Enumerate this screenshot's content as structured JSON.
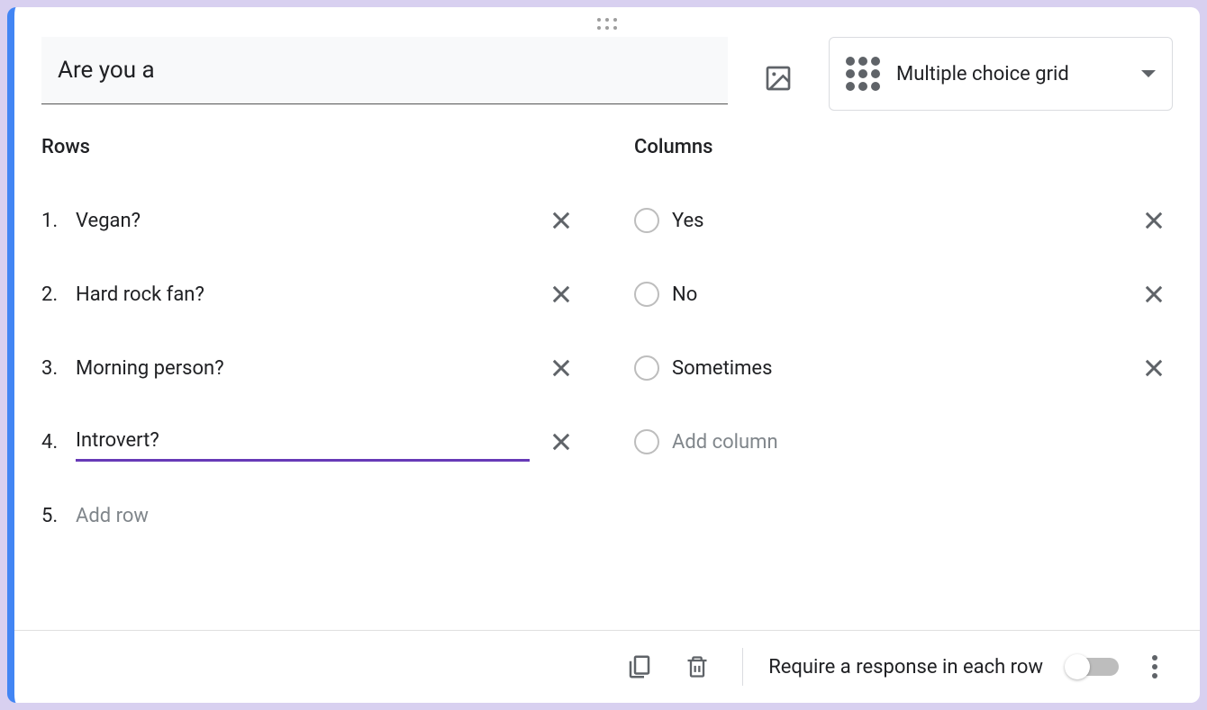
{
  "question": {
    "title": "Are you a"
  },
  "type_selector": {
    "label": "Multiple choice grid"
  },
  "sections": {
    "rows_title": "Rows",
    "columns_title": "Columns"
  },
  "rows": [
    {
      "num": "1.",
      "label": "Vegan?",
      "active": false
    },
    {
      "num": "2.",
      "label": "Hard rock fan?",
      "active": false
    },
    {
      "num": "3.",
      "label": "Morning person?",
      "active": false
    },
    {
      "num": "4.",
      "label": "Introvert?",
      "active": true
    }
  ],
  "add_row": {
    "num": "5.",
    "placeholder": "Add row"
  },
  "columns": [
    {
      "label": "Yes"
    },
    {
      "label": "No"
    },
    {
      "label": "Sometimes"
    }
  ],
  "add_column": {
    "placeholder": "Add column"
  },
  "footer": {
    "require_label": "Require a response in each row",
    "require_on": false
  }
}
